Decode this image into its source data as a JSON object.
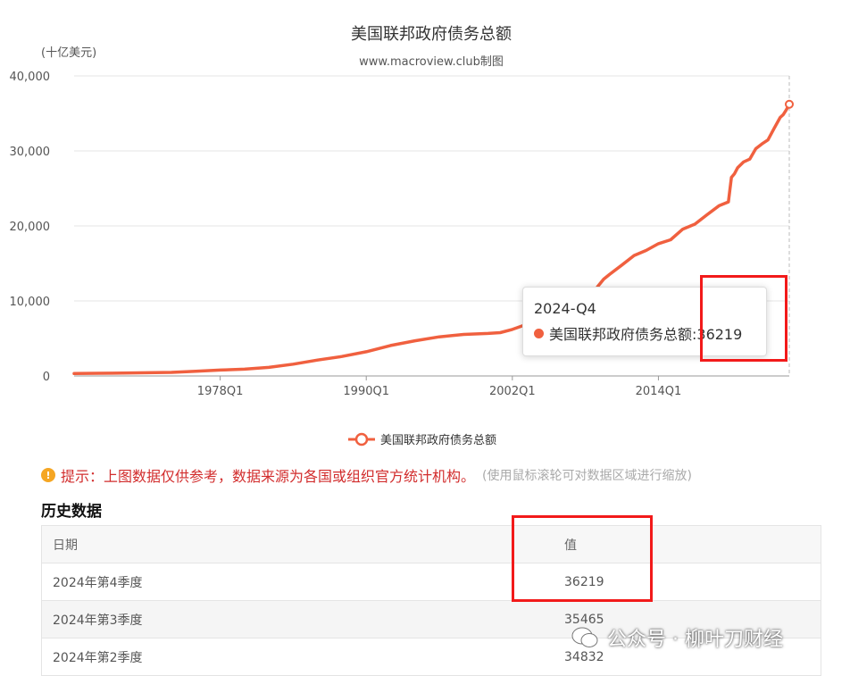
{
  "header": {
    "title": "美国联邦政府债务总额",
    "subtitle": "www.macroview.club制图",
    "unit": "(十亿美元)"
  },
  "colors": {
    "series": "#f0603f",
    "highlight": "#f21a1a",
    "tip_text": "#d22d2d"
  },
  "chart_data": {
    "type": "line",
    "title": "美国联邦政府债务总额",
    "ylabel": "(十亿美元)",
    "ylim": [
      0,
      40000
    ],
    "yticks": [
      "0",
      "10,000",
      "20,000",
      "30,000",
      "40,000"
    ],
    "ytick_values": [
      0,
      10000,
      20000,
      30000,
      40000
    ],
    "xticks": [
      "1978Q1",
      "1990Q1",
      "2002Q1",
      "2014Q1"
    ],
    "xtick_years": [
      1978.0,
      1990.0,
      2002.0,
      2014.0
    ],
    "x_range": [
      1966.0,
      2024.75
    ],
    "series": [
      {
        "name": "美国联邦政府债务总额",
        "x": [
          1966.0,
          1968.0,
          1970.0,
          1972.0,
          1974.0,
          1976.0,
          1978.0,
          1980.0,
          1982.0,
          1984.0,
          1986.0,
          1988.0,
          1990.0,
          1992.0,
          1994.0,
          1996.0,
          1998.0,
          2000.0,
          2001.0,
          2002.0,
          2003.0,
          2004.0,
          2005.0,
          2006.0,
          2007.0,
          2008.0,
          2008.5,
          2009.0,
          2009.5,
          2010.0,
          2011.0,
          2012.0,
          2013.0,
          2014.0,
          2015.0,
          2016.0,
          2017.0,
          2018.0,
          2019.0,
          2019.75,
          2020.0,
          2020.25,
          2020.5,
          2021.0,
          2021.5,
          2022.0,
          2022.5,
          2023.0,
          2023.5,
          2024.0,
          2024.25,
          2024.5,
          2024.75
        ],
        "values": [
          320,
          360,
          380,
          430,
          480,
          620,
          780,
          910,
          1140,
          1570,
          2120,
          2600,
          3230,
          4060,
          4690,
          5220,
          5530,
          5670,
          5770,
          6200,
          6780,
          7380,
          7930,
          8450,
          8950,
          10020,
          10700,
          11900,
          12900,
          13560,
          14790,
          16060,
          16740,
          17630,
          18150,
          19570,
          20240,
          21500,
          22720,
          23200,
          26480,
          26950,
          27750,
          28530,
          28900,
          30300,
          30930,
          31460,
          33000,
          34470,
          34832,
          35465,
          36219
        ]
      }
    ],
    "tooltip": {
      "date": "2024-Q4",
      "label": "美国联邦政府债务总额:36219"
    }
  },
  "legend": {
    "label": "美国联邦政府债务总额"
  },
  "tip": {
    "main": "提示：上图数据仅供参考，数据来源为各国或组织官方统计机构。",
    "aside": "(使用鼠标滚轮可对数据区域进行缩放)"
  },
  "history": {
    "title": "历史数据",
    "columns": [
      "日期",
      "值"
    ],
    "rows": [
      {
        "date": "2024年第4季度",
        "value": "36219"
      },
      {
        "date": "2024年第3季度",
        "value": "35465"
      },
      {
        "date": "2024年第2季度",
        "value": "34832"
      }
    ]
  },
  "watermark": {
    "text": "公众号 · 柳叶刀财经",
    "icon": "wechat-icon"
  }
}
